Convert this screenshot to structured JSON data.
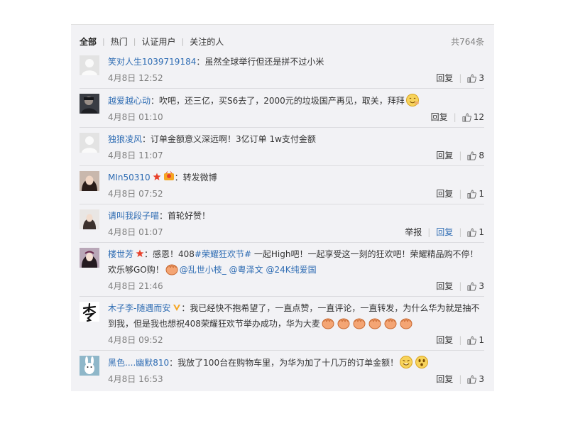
{
  "tabs": [
    "全部",
    "热门",
    "认证用户",
    "关注的人"
  ],
  "total_count": "共764条",
  "labels": {
    "reply": "回复",
    "report": "举报"
  },
  "colors": {
    "link": "#2e6cb3",
    "panel_bg": "#f2f2f5",
    "meta": "#808080"
  },
  "comments": [
    {
      "user": "笑对人生1039719184",
      "avatar": "default-avatar",
      "text": "：虽然全球举行但还是拼不过小米",
      "time": "4月8日 12:52",
      "likes": "3"
    },
    {
      "user": "越爱越心动",
      "avatar": "photo-avatar",
      "text": "：吹吧，还三亿，买S6去了，2000元的垃圾国产再见，取关，拜拜",
      "emoticon": "bye-emoticon",
      "time": "4月8日 01:10",
      "likes": "12"
    },
    {
      "user": "独狼凌风",
      "avatar": "default-avatar",
      "text": "：订单金额意义深远啊！3亿订单 1w支付金额",
      "time": "4月8日 11:07",
      "likes": "8"
    },
    {
      "user": "MIn50310",
      "avatar": "photo-avatar",
      "badges": [
        "star-badge",
        "vip-badge"
      ],
      "text": "：转发微博",
      "time": "4月8日 07:52",
      "likes": "1"
    },
    {
      "user": "请叫我段子喵",
      "avatar": "photo-avatar",
      "text": "：首轮好赞！",
      "time": "4月8日 01:07",
      "likes": "1",
      "show_report": true
    },
    {
      "user": "楼世芳",
      "avatar": "photo-avatar",
      "badges": [
        "star-badge"
      ],
      "text_a": "：感恩！408",
      "topic": "#荣耀狂欢节#",
      "text_b": " 一起High吧！一起享受这一刻的狂欢吧！荣耀精品购不停！欢乐够GO购！",
      "mentions": [
        "@乱世小枝_",
        "@粤泽文",
        "@24K纯爱国"
      ],
      "time": "4月8日 21:46",
      "likes": "3"
    },
    {
      "user": "木子李-随遇而安",
      "avatar": "calligraphy-avatar",
      "badges": [
        "v-badge"
      ],
      "text": "：我已经快不抱希望了，一直点赞，一直评论，一直转发，为什么华为就是抽不到我，但是我也想祝408荣耀狂欢节举办成功，华为大麦",
      "emoticon": "fist-emoticon",
      "time": "4月8日 09:52",
      "likes": "1"
    },
    {
      "user": "黑色....幽默810",
      "avatar": "cartoon-avatar",
      "text": "：我放了100台在购物车里，为华为加了十几万的订单金额！",
      "time": "4月8日 16:53",
      "likes": "3"
    }
  ]
}
